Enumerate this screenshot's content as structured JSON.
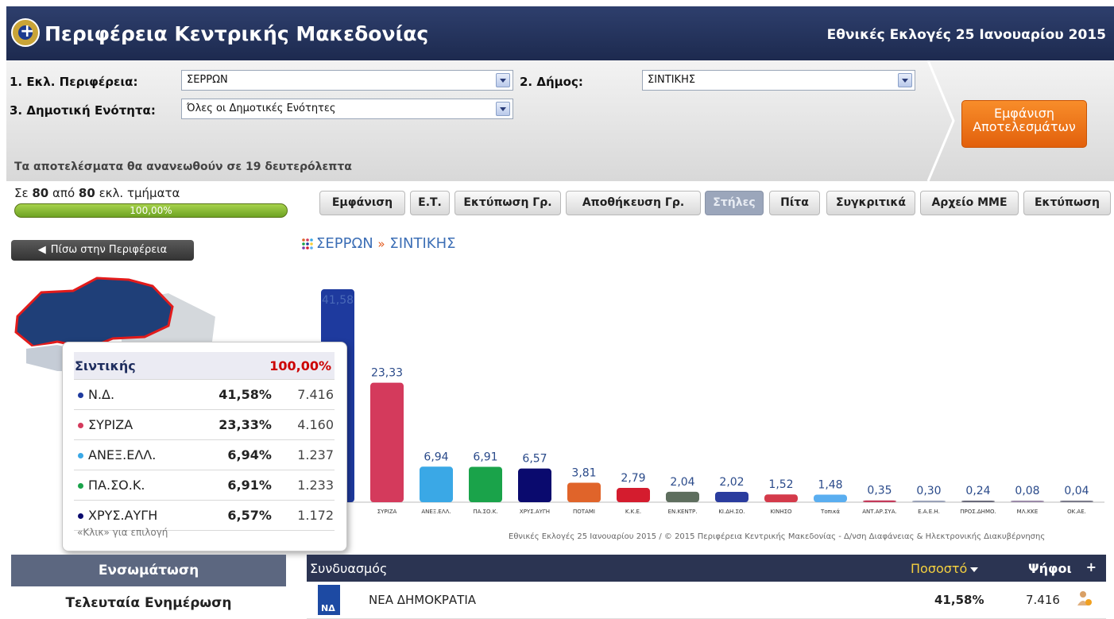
{
  "header": {
    "title": "Περιφέρεια Κεντρικής Μακεδονίας",
    "subtitle": "Εθνικές Εκλογές 25 Ιανουαρίου 2015"
  },
  "filters": {
    "region_label": "1. Εκλ. Περιφέρεια:",
    "region_value": "ΣΕΡΡΩΝ",
    "municipality_label": "2. Δήμος:",
    "municipality_value": "ΣΙΝΤΙΚΗΣ",
    "unit_label": "3. Δημοτική Ενότητα:",
    "unit_value": "Όλες οι Δημοτικές Ενότητες",
    "show_button": "Εμφάνιση Αποτελεσμάτων",
    "refresh_note": "Τα αποτελέσματα θα ανανεωθούν σε 19 δευτερόλεπτα"
  },
  "progress": {
    "prefix": "Σε",
    "counted": "80",
    "middle": "από",
    "total": "80",
    "suffix": "εκλ. τμήματα",
    "percent_text": "100,00%",
    "fraction": 1.0
  },
  "toolbar": [
    {
      "label": "Εμφάνιση",
      "active": false
    },
    {
      "label": "Ε.Τ.",
      "active": false
    },
    {
      "label": "Εκτύπωση Γρ.",
      "active": false
    },
    {
      "label": "Αποθήκευση Γρ.",
      "active": false
    },
    {
      "label": "Στήλες",
      "active": true
    },
    {
      "label": "Πίτα",
      "active": false
    },
    {
      "label": "Συγκριτικά",
      "active": false
    },
    {
      "label": "Αρχείο ΜΜΕ",
      "active": false
    },
    {
      "label": "Εκτύπωση",
      "active": false
    }
  ],
  "back_button": "Πίσω στην Περιφέρεια",
  "breadcrumb": {
    "first": "ΣΕΡΡΩΝ",
    "sep": "»",
    "second": "ΣΙΝΤΙΚΗΣ"
  },
  "chart_data": {
    "type": "bar",
    "categories": [
      "Ν.Δ.",
      "ΣΥΡΙΖΑ",
      "ΑΝΕΞ.ΕΛΛ.",
      "ΠΑ.ΣΟ.Κ.",
      "ΧΡΥΣ.ΑΥΓΗ",
      "ΠΟΤΑΜΙ",
      "Κ.Κ.Ε.",
      "ΕΝ.ΚΕΝΤΡ.",
      "ΚΙ.ΔΗ.ΣΟ.",
      "ΚΙΝΗΣΟ",
      "Τοπικά",
      "ΑΝΤ.ΑΡ.ΣΥΑ.",
      "Ε.Α.Ε.Η.",
      "ΠΡΟΣ.ΔΗΜΟ.",
      "ΜΛ.ΚΚΕ",
      "ΟΚ.ΑΕ."
    ],
    "values": [
      41.58,
      23.33,
      6.94,
      6.91,
      6.57,
      3.81,
      2.79,
      2.04,
      2.02,
      1.52,
      1.48,
      0.35,
      0.3,
      0.24,
      0.08,
      0.04
    ],
    "value_labels": [
      "41,58",
      "23,33",
      "6,94",
      "6,91",
      "6,57",
      "3,81",
      "2,79",
      "2,04",
      "2,02",
      "1,52",
      "1,48",
      "0,35",
      "0,30",
      "0,24",
      "0,08",
      "0,04"
    ],
    "colors": [
      "#1e3a9e",
      "#d43a5c",
      "#3aa8e6",
      "#1aa34a",
      "#0a0a6e",
      "#e0642a",
      "#d41c2e",
      "#5e6e5e",
      "#2a3c9e",
      "#d43a4a",
      "#5aaef0",
      "#c43a5a",
      "#9aa2b8",
      "#6a6a7a",
      "#9a8aa8",
      "#7a7a8a"
    ],
    "ylim": [
      0,
      45
    ],
    "credit": "Εθνικές Εκλογές 25 Ιανουαρίου 2015 / © 2015 Περιφέρεια Κεντρικής Μακεδονίας - Δ/νση Διαφάνειας & Ηλεκτρονικής Διακυβέρνησης"
  },
  "tooltip": {
    "title": "Σιντικής",
    "total_pct": "100,00%",
    "rows": [
      {
        "party": "Ν.Δ.",
        "pct": "41,58%",
        "votes": "7.416",
        "color": "#1e3a9e"
      },
      {
        "party": "ΣΥΡΙΖΑ",
        "pct": "23,33%",
        "votes": "4.160",
        "color": "#d43a5c"
      },
      {
        "party": "ΑΝΕΞ.ΕΛΛ.",
        "pct": "6,94%",
        "votes": "1.237",
        "color": "#3aa8e6"
      },
      {
        "party": "ΠΑ.ΣΟ.Κ.",
        "pct": "6,91%",
        "votes": "1.233",
        "color": "#1aa34a"
      },
      {
        "party": "ΧΡΥΣ.ΑΥΓΗ",
        "pct": "6,57%",
        "votes": "1.172",
        "color": "#0a0a6e"
      }
    ],
    "hint": "«Κλικ» για επιλογή"
  },
  "sidebar": {
    "embed": "Ενσωμάτωση",
    "last_update": "Τελευταία Ενημέρωση"
  },
  "results_table": {
    "col_combo": "Συνδυασμός",
    "col_pct": "Ποσοστό",
    "col_votes": "Ψήφοι",
    "plus": "+",
    "rows": [
      {
        "logo_text": "ΝΔ",
        "name": "ΝΕΑ ΔΗΜΟΚΡΑΤΙΑ",
        "pct": "41,58%",
        "votes": "7.416"
      }
    ]
  }
}
